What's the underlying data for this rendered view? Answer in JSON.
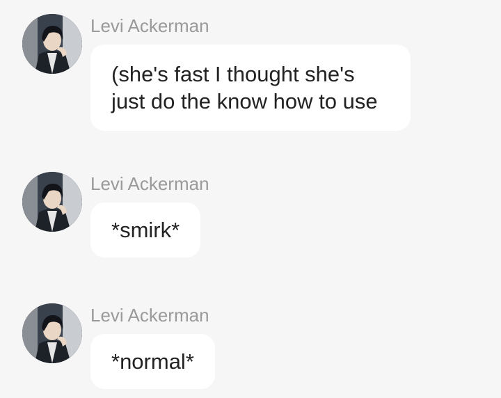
{
  "messages": [
    {
      "sender": "Levi Ackerman",
      "avatar": "character-portrait",
      "text": "(she's fast I thought she's\njust do the know how to use"
    },
    {
      "sender": "Levi Ackerman",
      "avatar": "character-portrait",
      "text": "*smirk*"
    },
    {
      "sender": "Levi Ackerman",
      "avatar": "character-portrait",
      "text": "*normal*"
    }
  ],
  "colors": {
    "background": "#f6f6f6",
    "bubble": "#ffffff",
    "sender_name": "#9a9a9a",
    "message_text": "#222222"
  }
}
